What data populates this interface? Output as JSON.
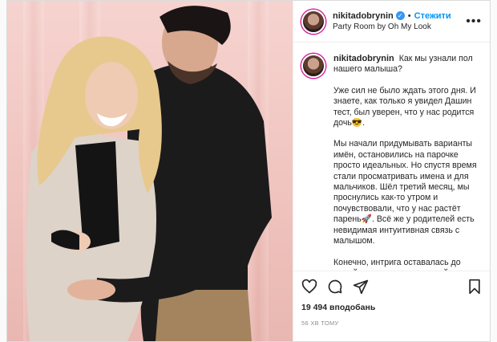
{
  "header": {
    "username": "nikitadobrynin",
    "verified_icon": "verified-badge-icon",
    "dot": "•",
    "follow_label": "Стежити",
    "location": "Party Room by Oh My Look",
    "more_icon": "ellipsis-icon"
  },
  "caption": {
    "username": "nikitadobrynin",
    "title": "Как мы узнали пол нашего малыша?",
    "paragraph1": "Уже сил не было ждать этого дня. И знаете, как только я увидел Дашин тест, был уверен, что у нас родится дочь😎.",
    "paragraph2": "Мы начали придумывать варианты имён, остановились на парочке просто идеальных. Но спустя время стали просматривать имена и для мальчиков. Шёл третий месяц, мы проснулись как-то утром и почувствовали, что у нас растёт парень🚀. Всё же у родителей есть невидимая интуитивная связь с малышом.",
    "paragraph3": "Конечно, интрига оставалась до самой вечеринки, на которой мы"
  },
  "actions": {
    "icons": [
      "heart-icon",
      "comment-icon",
      "share-icon",
      "bookmark-icon"
    ],
    "likes": "19 494 вподобань",
    "time": "56 хв тому"
  },
  "photo": {
    "description_icon": "couple-photo"
  }
}
